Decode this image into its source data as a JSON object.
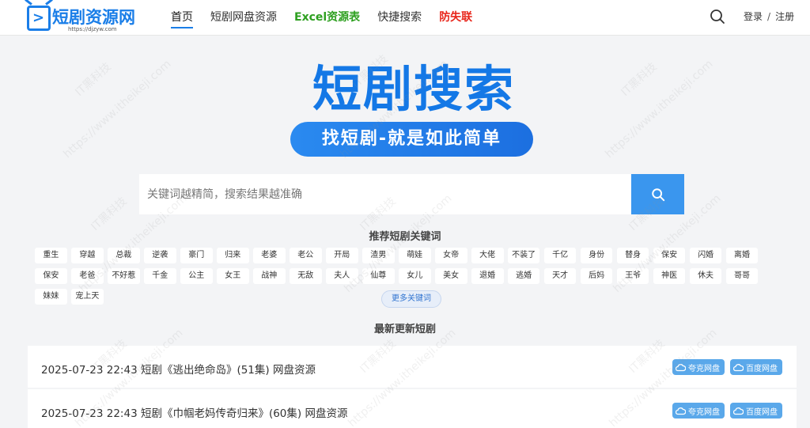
{
  "logo": {
    "name": "短剧资源网",
    "url": "https://djzyw.com"
  },
  "nav": [
    {
      "label": "首页",
      "style": "active"
    },
    {
      "label": "短剧网盘资源",
      "style": ""
    },
    {
      "label": "Excel资源表",
      "style": "green"
    },
    {
      "label": "快捷搜索",
      "style": ""
    },
    {
      "label": "防失联",
      "style": "red"
    }
  ],
  "auth": {
    "login": "登录",
    "sep": "/",
    "register": "注册"
  },
  "hero": {
    "title": "短剧搜索",
    "slogan": "找短剧-就是如此简单"
  },
  "search": {
    "placeholder": "关键词越精简，搜索结果越准确"
  },
  "keywords": {
    "title": "推荐短剧关键词",
    "tags": [
      "重生",
      "穿越",
      "总裁",
      "逆袭",
      "豪门",
      "归来",
      "老婆",
      "老公",
      "开局",
      "渣男",
      "萌娃",
      "女帝",
      "大佬",
      "不装了",
      "千亿",
      "身份",
      "替身",
      "保安",
      "闪婚",
      "离婚",
      "保安",
      "老爸",
      "不好惹",
      "千金",
      "公主",
      "女王",
      "战神",
      "无敌",
      "夫人",
      "仙尊",
      "女儿",
      "美女",
      "退婚",
      "逃婚",
      "天才",
      "后妈",
      "王爷",
      "神医",
      "休夫",
      "哥哥",
      "妹妹",
      "宠上天"
    ],
    "more": "更多关键词"
  },
  "latest": {
    "title": "最新更新短剧",
    "items": [
      {
        "text": "2025-07-23 22:43 短剧《逃出绝命岛》(51集) 网盘资源",
        "quark": "夸克网盘",
        "baidu": "百度网盘"
      },
      {
        "text": "2025-07-23 22:43 短剧《巾帼老妈传奇归来》(60集) 网盘资源",
        "quark": "夸克网盘",
        "baidu": "百度网盘"
      }
    ]
  },
  "watermark": {
    "text1": "IT黑科技",
    "text2": "https://www.itheikeji.com"
  },
  "colors": {
    "brand": "#1a7ee8",
    "green_link": "#2ea020",
    "red_link": "#e8261b",
    "search_button": "#3a96ee",
    "badge": "#5aa8ea"
  }
}
